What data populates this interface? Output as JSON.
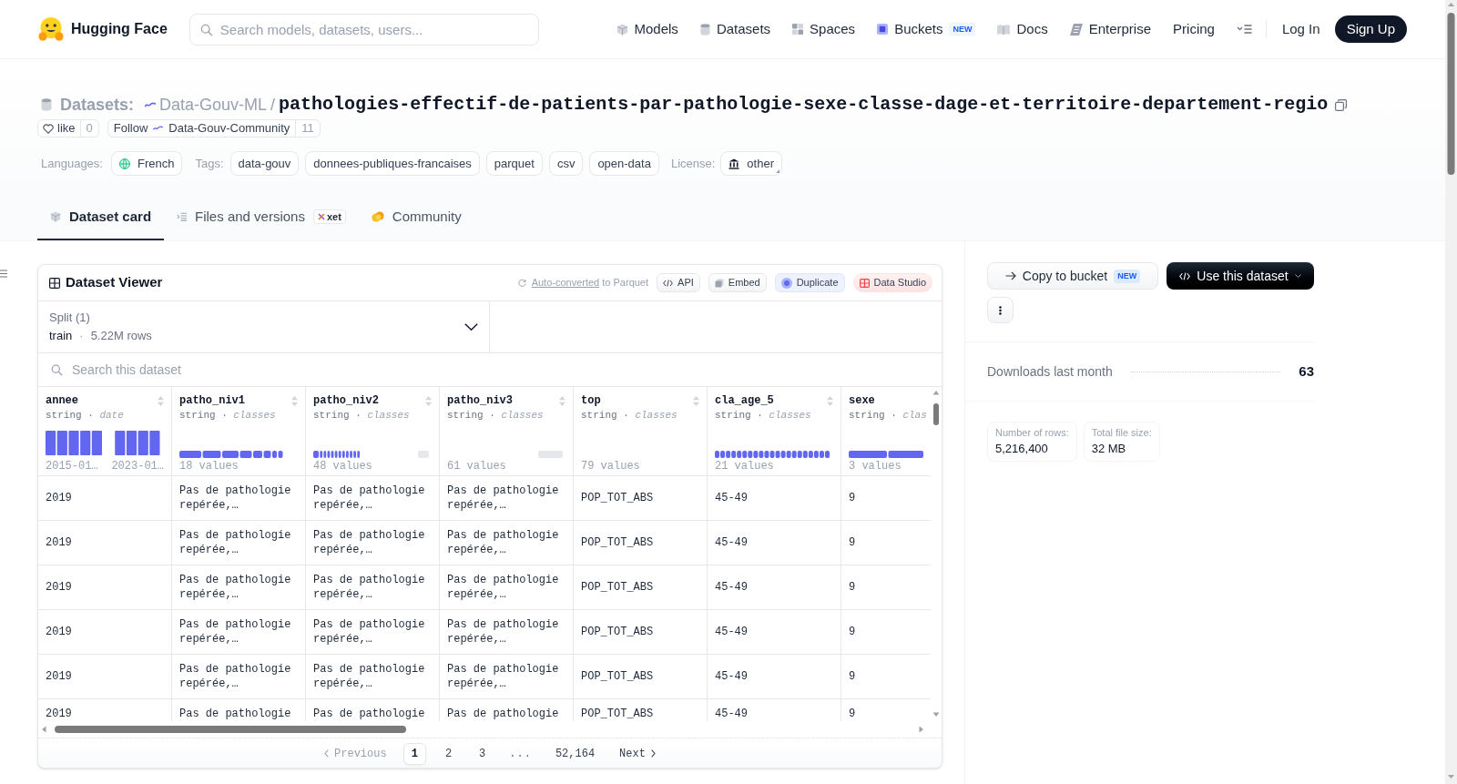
{
  "header": {
    "logo_text": "Hugging Face",
    "search": {
      "placeholder": "Search models, datasets, users..."
    },
    "nav": [
      {
        "label": "Models"
      },
      {
        "label": "Datasets"
      },
      {
        "label": "Spaces"
      },
      {
        "label": "Buckets",
        "badge": "NEW"
      },
      {
        "label": "Docs"
      },
      {
        "label": "Enterprise"
      },
      {
        "label": "Pricing"
      }
    ],
    "log_in": "Log In",
    "sign_up": "Sign Up"
  },
  "repo": {
    "type_label": "Datasets:",
    "owner": "Data-Gouv-ML",
    "separator": "/",
    "name": "pathologies-effectif-de-patients-par-pathologie-sexe-classe-dage-et-territoire-departement-regio",
    "like": {
      "label": "like",
      "count": "0"
    },
    "follow": {
      "label": "Follow",
      "org": "Data-Gouv-Community",
      "count": "11"
    },
    "languages": {
      "label": "Languages:",
      "items": [
        "French"
      ]
    },
    "tags": {
      "label": "Tags:",
      "items": [
        "data-gouv",
        "donnees-publiques-francaises",
        "parquet",
        "csv",
        "open-data"
      ]
    },
    "license": {
      "label": "License:",
      "value": "other"
    }
  },
  "tabs": [
    {
      "label": "Dataset card",
      "selected": true
    },
    {
      "label": "Files and versions",
      "selected": false,
      "badge": "xet"
    },
    {
      "label": "Community",
      "selected": false
    }
  ],
  "viewer": {
    "title": "Dataset Viewer",
    "note": {
      "link": "Auto-converted",
      "text": "to Parquet"
    },
    "actions": [
      {
        "label": "API",
        "kind": "plain"
      },
      {
        "label": "Embed",
        "kind": "plain"
      },
      {
        "label": "Duplicate",
        "kind": "tinted"
      },
      {
        "label": "Data Studio",
        "kind": "studio"
      }
    ],
    "split": {
      "label": "Split (1)",
      "name": "train",
      "separator": "·",
      "rows": "5.22M rows"
    },
    "search": {
      "placeholder": "Search this dataset"
    },
    "columns": [
      {
        "name": "annee",
        "type": "string · *date*",
        "kind": "histogram",
        "labels": [
          "2015-01…",
          "2023-01…"
        ]
      },
      {
        "name": "patho_niv1",
        "type": "string · *classes*",
        "kind": "classes",
        "labels": [
          "18 values"
        ]
      },
      {
        "name": "patho_niv2",
        "type": "string · *classes*",
        "kind": "classes",
        "labels": [
          "48 values"
        ]
      },
      {
        "name": "patho_niv3",
        "type": "string · *classes*",
        "kind": "classes",
        "labels": [
          "61 values"
        ]
      },
      {
        "name": "top",
        "type": "string · *classes*",
        "kind": "classes",
        "labels": [
          "79 values"
        ]
      },
      {
        "name": "cla_age_5",
        "type": "string · *classes*",
        "kind": "classes",
        "labels": [
          "21 values"
        ]
      },
      {
        "name": "sexe",
        "type": "string · *clas*",
        "kind": "classes",
        "labels": [
          "3 values"
        ]
      }
    ],
    "rows": [
      [
        "2019",
        "Pas de pathologie repérée,…",
        "Pas de pathologie repérée,…",
        "Pas de pathologie repérée,…",
        "POP_TOT_ABS",
        "45-49",
        "9"
      ],
      [
        "2019",
        "Pas de pathologie repérée,…",
        "Pas de pathologie repérée,…",
        "Pas de pathologie repérée,…",
        "POP_TOT_ABS",
        "45-49",
        "9"
      ],
      [
        "2019",
        "Pas de pathologie repérée,…",
        "Pas de pathologie repérée,…",
        "Pas de pathologie repérée,…",
        "POP_TOT_ABS",
        "45-49",
        "9"
      ],
      [
        "2019",
        "Pas de pathologie repérée,…",
        "Pas de pathologie repérée,…",
        "Pas de pathologie repérée,…",
        "POP_TOT_ABS",
        "45-49",
        "9"
      ],
      [
        "2019",
        "Pas de pathologie repérée,…",
        "Pas de pathologie repérée,…",
        "Pas de pathologie repérée,…",
        "POP_TOT_ABS",
        "45-49",
        "9"
      ],
      [
        "2019",
        "Pas de pathologie",
        "Pas de pathologie",
        "Pas de pathologie",
        "POP_TOT_ABS",
        "45-49",
        "9"
      ]
    ],
    "pagination": {
      "previous": {
        "label": "Previous",
        "disabled": true
      },
      "pages": [
        {
          "label": "1",
          "kind": "page",
          "selected": true
        },
        {
          "label": "2",
          "kind": "page",
          "selected": false
        },
        {
          "label": "3",
          "kind": "page",
          "selected": false
        },
        {
          "label": "...",
          "kind": "ellipsis",
          "selected": false
        },
        {
          "label": "52,164",
          "kind": "page",
          "selected": false
        }
      ],
      "next": {
        "label": "Next",
        "disabled": false
      }
    }
  },
  "sidebar": {
    "copy_button": {
      "label": "Copy to bucket",
      "badge": "NEW"
    },
    "use_button": {
      "label": "Use this dataset"
    },
    "downloads": {
      "label": "Downloads last month",
      "value": "63"
    },
    "stats": [
      {
        "label": "Number of rows:",
        "value": "5,216,400"
      },
      {
        "label": "Total file size:",
        "value": "32 MB"
      }
    ]
  }
}
